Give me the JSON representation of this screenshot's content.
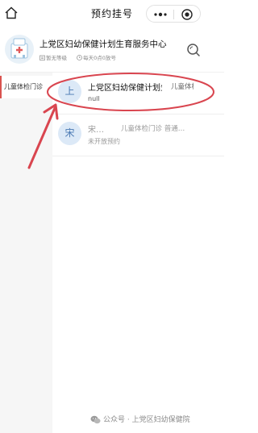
{
  "navbar": {
    "title": "预约挂号",
    "home_icon": "home-icon",
    "more_icon": "more-dots-icon",
    "close_icon": "close-target-icon"
  },
  "hospital": {
    "name": "上党区妇幼保健计划生育服务中心",
    "level": "暂无等级",
    "schedule": "每天0点0放号",
    "logo_icon": "hospital-logo-icon",
    "search_icon": "search-icon"
  },
  "sidebar": {
    "items": [
      {
        "label": "儿童体检门诊"
      }
    ],
    "accent_color": "#d9534f"
  },
  "doctors": [
    {
      "avatar": "上",
      "name": "上党区妇幼保健计划生育服务中心",
      "department": "儿童体检门诊",
      "description": "null",
      "highlighted": true
    },
    {
      "avatar": "宋",
      "name": "宋…",
      "department": "儿童体检门诊 普通…",
      "description": "未开放预约",
      "highlighted": false
    }
  ],
  "annotation": {
    "color": "#d9454f"
  },
  "watermark": {
    "text": "公众号 · 上党区妇幼保健院"
  }
}
